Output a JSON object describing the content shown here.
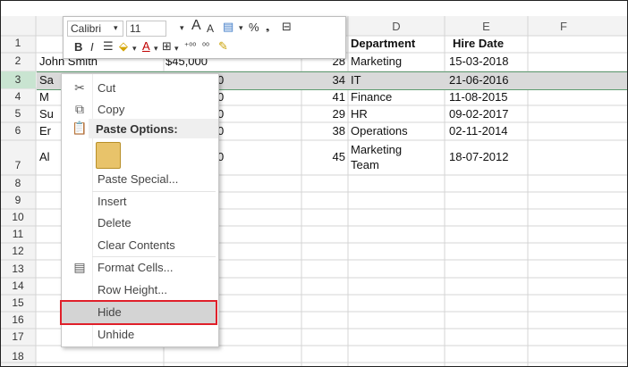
{
  "columns": [
    "D",
    "E",
    "F"
  ],
  "row_numbers": [
    "1",
    "2",
    "3",
    "4",
    "5",
    "6",
    "7",
    "8",
    "9",
    "10",
    "11",
    "12",
    "13",
    "14",
    "15",
    "16",
    "17",
    "18"
  ],
  "header_row": {
    "department": "Department",
    "hire_date": "Hire Date"
  },
  "rows": [
    {
      "name": "John Smith",
      "salary": "$45,000",
      "age": "28",
      "department": "Marketing",
      "hire_date": "15-03-2018"
    },
    {
      "name": "Sa",
      "salary": "0",
      "age": "34",
      "department": "IT",
      "hire_date": "21-06-2016"
    },
    {
      "name": "M",
      "salary": "0",
      "age": "41",
      "department": "Finance",
      "hire_date": "11-08-2015"
    },
    {
      "name": "Su",
      "salary": "0",
      "age": "29",
      "department": "HR",
      "hire_date": "09-02-2017"
    },
    {
      "name": "Er",
      "salary": "0",
      "age": "38",
      "department": "Operations",
      "hire_date": "02-11-2014"
    },
    {
      "name": "Al",
      "salary": "0",
      "age": "45",
      "department_line1": "Marketing",
      "department_line2": "Team",
      "hire_date": "18-07-2012"
    }
  ],
  "mini_toolbar": {
    "font_name": "Calibri",
    "font_size": "11",
    "bold": "B",
    "italic": "I",
    "percent": "%"
  },
  "context_menu": {
    "cut": "Cut",
    "copy": "Copy",
    "paste_options": "Paste Options:",
    "paste_special": "Paste Special...",
    "insert": "Insert",
    "delete": "Delete",
    "clear_contents": "Clear Contents",
    "format_cells": "Format Cells...",
    "row_height": "Row Height...",
    "hide": "Hide",
    "unhide": "Unhide"
  },
  "colors": {
    "selection_border": "#5f9c71",
    "highlight_box": "#e0202a"
  }
}
